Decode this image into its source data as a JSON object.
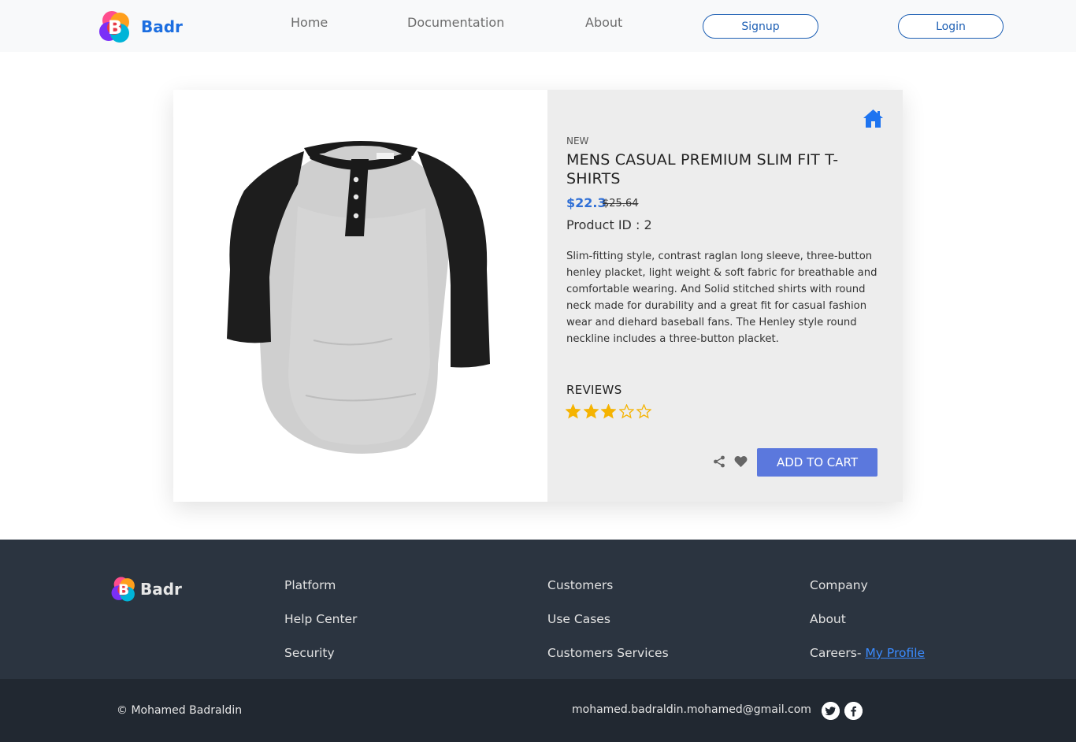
{
  "nav": {
    "brand": "Badr",
    "links": [
      "Home",
      "Documentation",
      "About"
    ],
    "signup": "Signup",
    "login": "Login"
  },
  "product": {
    "badge": "NEW",
    "title": "MENS CASUAL PREMIUM SLIM FIT T-SHIRTS",
    "price": "$22.3",
    "old_price": "$25.64",
    "product_id_text": "Product ID : 2",
    "description": "Slim-fitting style, contrast raglan long sleeve, three-button henley placket, light weight & soft fabric for breathable and comfortable wearing. And Solid stitched shirts with round neck made for durability and a great fit for casual fashion wear and diehard baseball fans. The Henley style round neckline includes a three-button placket.",
    "reviews_label": "REVIEWS",
    "rating": 3,
    "rating_max": 5,
    "add_to_cart": "ADD TO CART",
    "image_icon": "tshirt-image",
    "home_icon": "home-icon"
  },
  "footer": {
    "brand": "Badr",
    "col1": [
      "Platform",
      "Help Center",
      "Security"
    ],
    "col2": [
      "Customers",
      "Use Cases",
      "Customers Services"
    ],
    "col3": [
      "Company",
      "About"
    ],
    "careers_text": "Careers-",
    "profile_link": "My Profile",
    "copyright": "© Mohamed Badraldin",
    "email": "mohamed.badraldin.mohamed@gmail.com",
    "social": [
      "twitter-icon",
      "facebook-icon"
    ]
  },
  "colors": {
    "brand": "#1c6ee0",
    "accent_button": "#5b78dd",
    "price": "#2f6fd6",
    "star": "#f5b301",
    "footer_top": "#2b3440",
    "footer_bottom": "#212831",
    "link": "#3a8bff"
  }
}
